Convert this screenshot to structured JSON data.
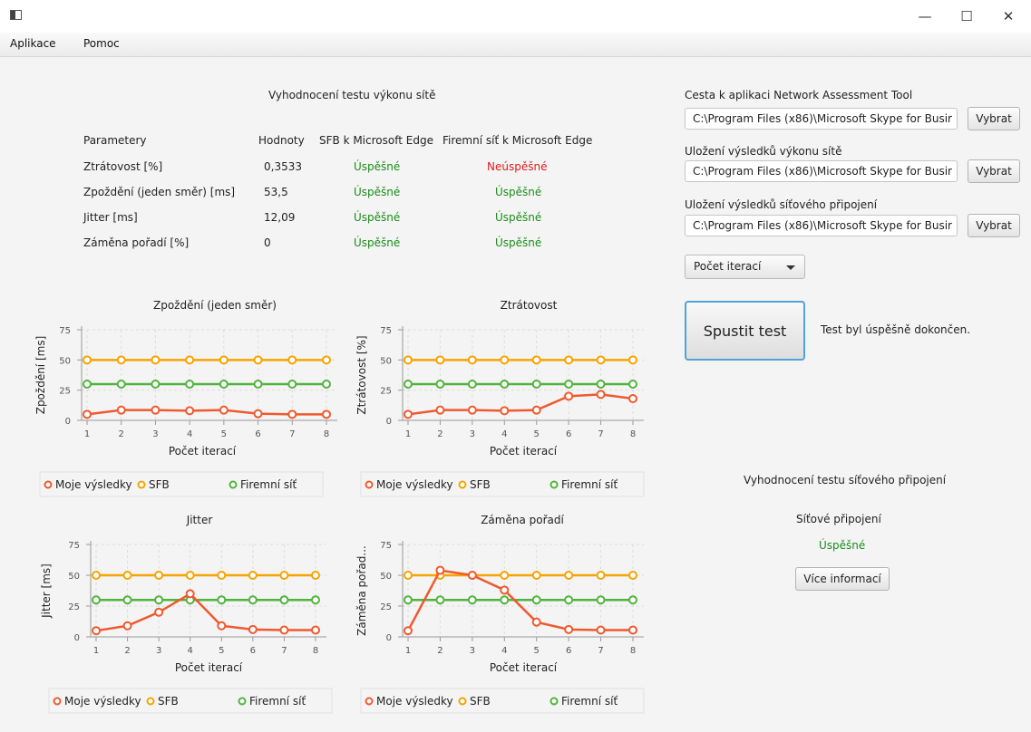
{
  "window": {
    "minimize_glyph": "—",
    "maximize_glyph": "☐",
    "close_glyph": "✕"
  },
  "menu": {
    "items": [
      "Aplikace",
      "Pomoc"
    ]
  },
  "results": {
    "title": "Vyhodnocení testu výkonu sítě",
    "headers": [
      "Parametery",
      "Hodnoty",
      "SFB k Microsoft Edge",
      "Firemní síť k Microsoft Edge"
    ],
    "rows": [
      {
        "param": "Ztrátovost [%]",
        "value": "0,3533",
        "sfb": "Úspěšné",
        "firm": "Neúspěšné",
        "sfb_ok": true,
        "firm_ok": false
      },
      {
        "param": "Zpoždění (jeden směr) [ms]",
        "value": "53,5",
        "sfb": "Úspěšné",
        "firm": "Úspěšné",
        "sfb_ok": true,
        "firm_ok": true
      },
      {
        "param": "Jitter [ms]",
        "value": "12,09",
        "sfb": "Úspěšné",
        "firm": "Úspěšné",
        "sfb_ok": true,
        "firm_ok": true
      },
      {
        "param": "Záměna pořadí [%]",
        "value": "0",
        "sfb": "Úspěšné",
        "firm": "Úspěšné",
        "sfb_ok": true,
        "firm_ok": true
      }
    ]
  },
  "paths": [
    {
      "label": "Cesta k aplikaci Network Assessment Tool",
      "value": "C:\\Program Files (x86)\\Microsoft Skype for Busir",
      "button": "Vybrat"
    },
    {
      "label": "Uložení výsledků výkonu sítě",
      "value": "C:\\Program Files (x86)\\Microsoft Skype for Busir",
      "button": "Vybrat"
    },
    {
      "label": "Uložení výsledků síťového připojení",
      "value": "C:\\Program Files (x86)\\Microsoft Skype for Busir",
      "button": "Vybrat"
    }
  ],
  "controls": {
    "iterations_combo": "Počet iterací",
    "run_button": "Spustit test",
    "status": "Test byl úspěšně dokončen."
  },
  "connection": {
    "title": "Vyhodnocení testu síťového připojení",
    "label": "Síťové připojení",
    "status": "Úspěšné",
    "more_button": "Více informací"
  },
  "colors": {
    "mine": "#f0592f",
    "sfb": "#f6a400",
    "firm": "#50b43c",
    "success": "#1a8c1a",
    "fail": "#e01b1b"
  },
  "chart_data": [
    {
      "type": "line",
      "title": "Zpoždění (jeden směr)",
      "xlabel": "Počet iterací",
      "ylabel": "Zpoždění [ms]",
      "x": [
        1,
        2,
        3,
        4,
        5,
        6,
        7,
        8
      ],
      "ylim": [
        0,
        75
      ],
      "yticks": [
        0,
        25,
        50,
        75
      ],
      "grid": true,
      "series": [
        {
          "name": "Moje výsledky",
          "values": [
            5,
            8.5,
            8.5,
            8,
            8.5,
            5.5,
            5,
            5
          ]
        },
        {
          "name": "SFB",
          "values": [
            50,
            50,
            50,
            50,
            50,
            50,
            50,
            50
          ]
        },
        {
          "name": "Firemní síť",
          "values": [
            30,
            30,
            30,
            30,
            30,
            30,
            30,
            30
          ]
        }
      ]
    },
    {
      "type": "line",
      "title": "Ztrátovost",
      "xlabel": "Počet iterací",
      "ylabel": "Ztrátovost [%]",
      "x": [
        1,
        2,
        3,
        4,
        5,
        6,
        7,
        8
      ],
      "ylim": [
        0,
        75
      ],
      "yticks": [
        0,
        25,
        50,
        75
      ],
      "grid": true,
      "series": [
        {
          "name": "Moje výsledky",
          "values": [
            5,
            8.5,
            8.5,
            8,
            8.5,
            20,
            21.5,
            18
          ]
        },
        {
          "name": "SFB",
          "values": [
            50,
            50,
            50,
            50,
            50,
            50,
            50,
            50
          ]
        },
        {
          "name": "Firemní síť",
          "values": [
            30,
            30,
            30,
            30,
            30,
            30,
            30,
            30
          ]
        }
      ]
    },
    {
      "type": "line",
      "title": "Jitter",
      "xlabel": "Počet iterací",
      "ylabel": "Jitter [ms]",
      "x": [
        1,
        2,
        3,
        4,
        5,
        6,
        7,
        8
      ],
      "ylim": [
        0,
        75
      ],
      "yticks": [
        0,
        25,
        50,
        75
      ],
      "grid": true,
      "series": [
        {
          "name": "Moje výsledky",
          "values": [
            5,
            9,
            20,
            35,
            9,
            6,
            5.5,
            5.5
          ]
        },
        {
          "name": "SFB",
          "values": [
            50,
            50,
            50,
            50,
            50,
            50,
            50,
            50
          ]
        },
        {
          "name": "Firemní síť",
          "values": [
            30,
            30,
            30,
            30,
            30,
            30,
            30,
            30
          ]
        }
      ]
    },
    {
      "type": "line",
      "title": "Záměna pořadí",
      "xlabel": "Počet iterací",
      "ylabel": "Záměna pořad...",
      "x": [
        1,
        2,
        3,
        4,
        5,
        6,
        7,
        8
      ],
      "ylim": [
        0,
        75
      ],
      "yticks": [
        0,
        25,
        50,
        75
      ],
      "grid": true,
      "series": [
        {
          "name": "Moje výsledky",
          "values": [
            5,
            54,
            50,
            38,
            12,
            6,
            5.5,
            5.5
          ]
        },
        {
          "name": "SFB",
          "values": [
            50,
            50,
            50,
            50,
            50,
            50,
            50,
            50
          ]
        },
        {
          "name": "Firemní síť",
          "values": [
            30,
            30,
            30,
            30,
            30,
            30,
            30,
            30
          ]
        }
      ]
    }
  ]
}
